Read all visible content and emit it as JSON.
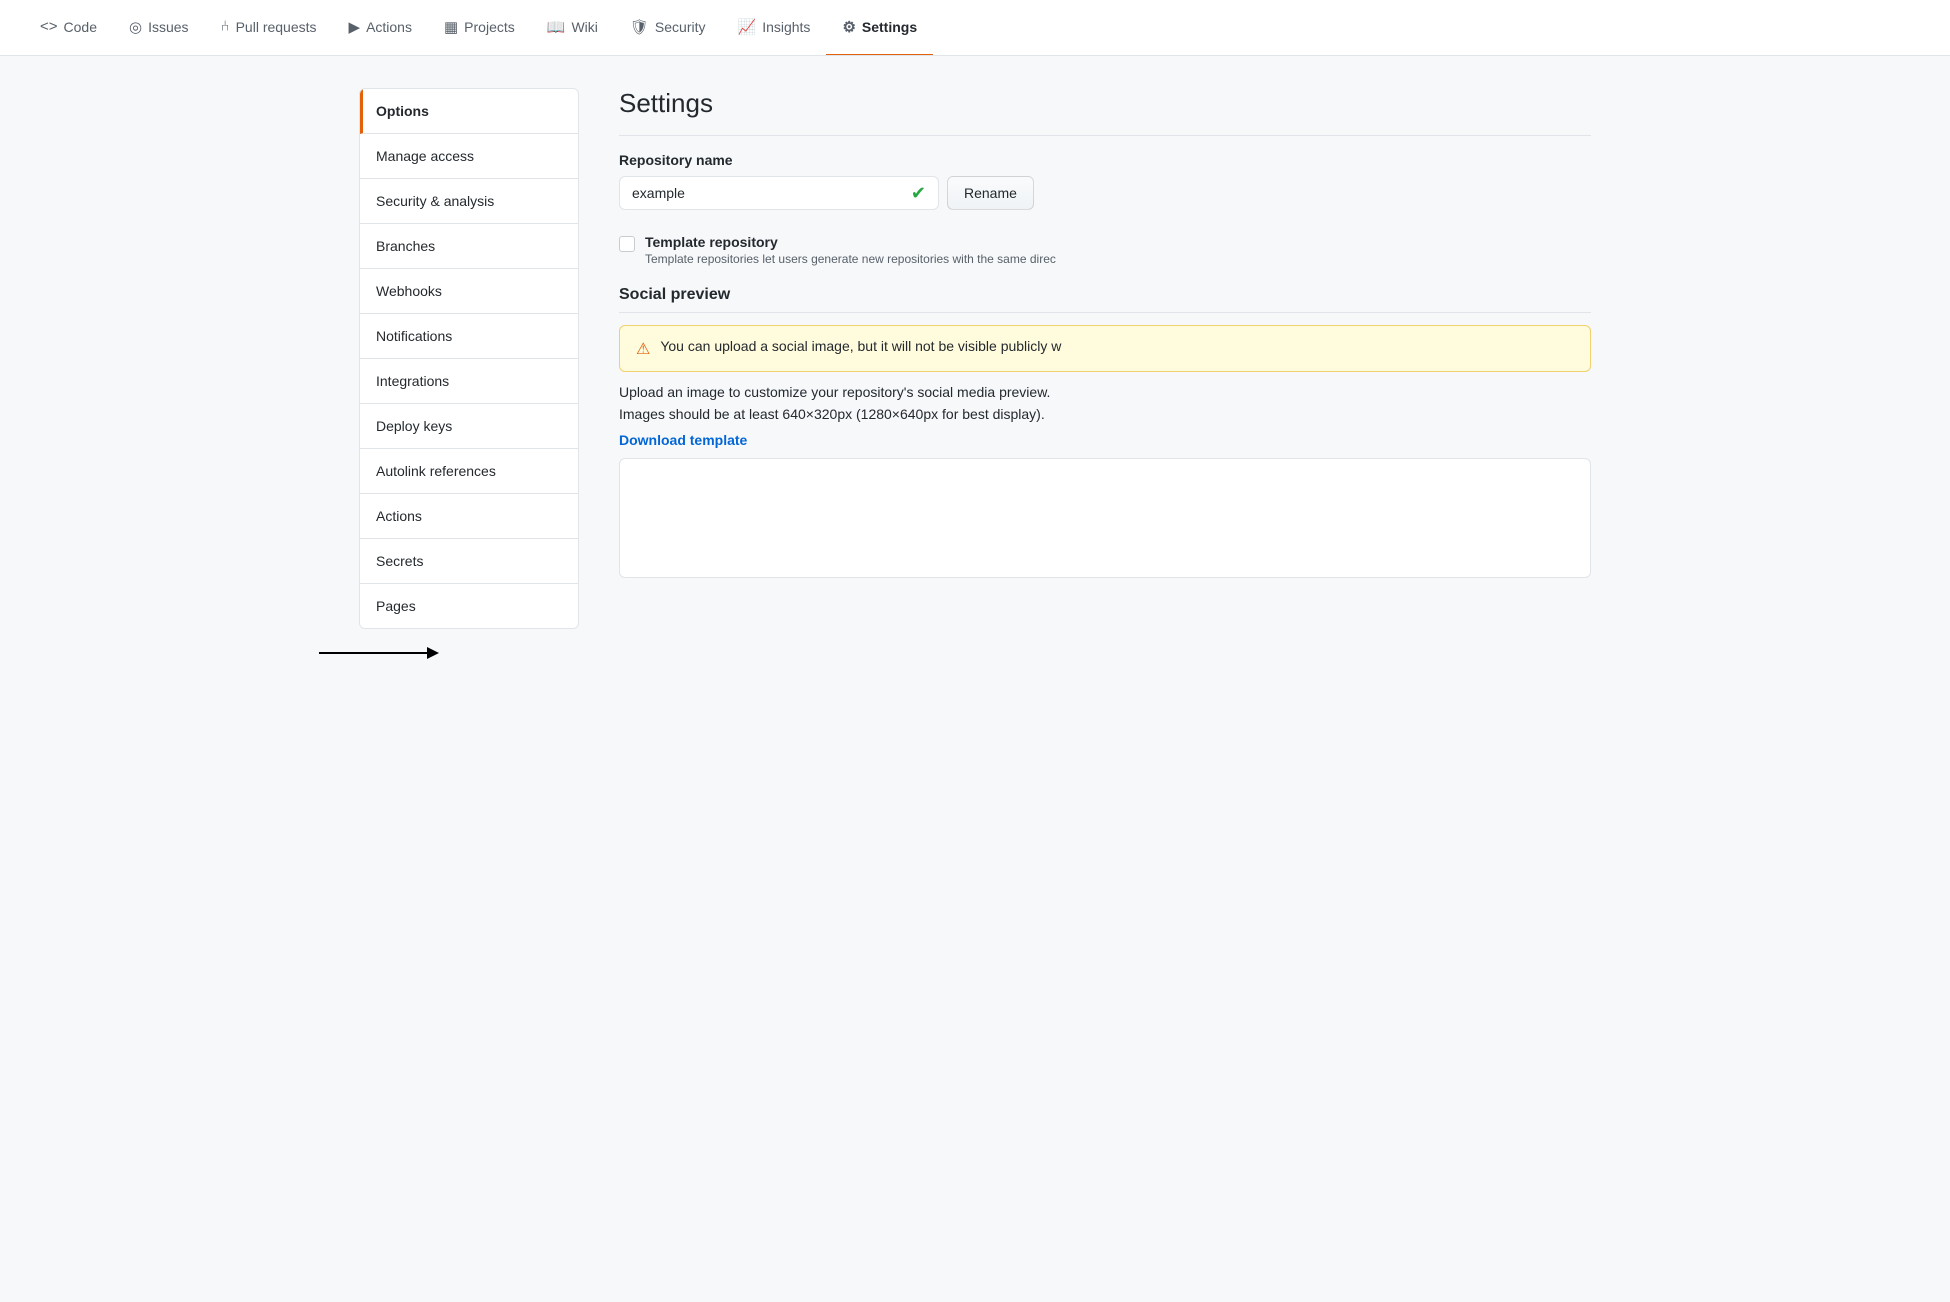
{
  "nav": {
    "items": [
      {
        "label": "Code",
        "icon": "◇",
        "active": false
      },
      {
        "label": "Issues",
        "icon": "◎",
        "active": false
      },
      {
        "label": "Pull requests",
        "icon": "⑃",
        "active": false
      },
      {
        "label": "Actions",
        "icon": "▶",
        "active": false
      },
      {
        "label": "Projects",
        "icon": "▦",
        "active": false
      },
      {
        "label": "Wiki",
        "icon": "📖",
        "active": false
      },
      {
        "label": "Security",
        "icon": "🛡",
        "active": false
      },
      {
        "label": "Insights",
        "icon": "📈",
        "active": false
      },
      {
        "label": "Settings",
        "icon": "⚙",
        "active": true
      }
    ]
  },
  "sidebar": {
    "items": [
      {
        "label": "Options",
        "active": true
      },
      {
        "label": "Manage access",
        "active": false
      },
      {
        "label": "Security & analysis",
        "active": false
      },
      {
        "label": "Branches",
        "active": false
      },
      {
        "label": "Webhooks",
        "active": false
      },
      {
        "label": "Notifications",
        "active": false
      },
      {
        "label": "Integrations",
        "active": false
      },
      {
        "label": "Deploy keys",
        "active": false
      },
      {
        "label": "Autolink references",
        "active": false
      },
      {
        "label": "Actions",
        "active": false
      },
      {
        "label": "Secrets",
        "active": false
      },
      {
        "label": "Pages",
        "active": false
      }
    ]
  },
  "content": {
    "title": "Settings",
    "repo_name_label": "Repository name",
    "repo_name_value": "example",
    "rename_button": "Rename",
    "template_repo_label": "Template repository",
    "template_repo_desc": "Template repositories let users generate new repositories with the same direc",
    "social_preview_heading": "Social preview",
    "warning_text": "You can upload a social image, but it will not be visible publicly w",
    "upload_desc": "Upload an image to customize your repository's social media preview.",
    "image_size_desc": "Images should be at least 640×320px (1280×640px for best display).",
    "download_template_link": "Download template"
  }
}
